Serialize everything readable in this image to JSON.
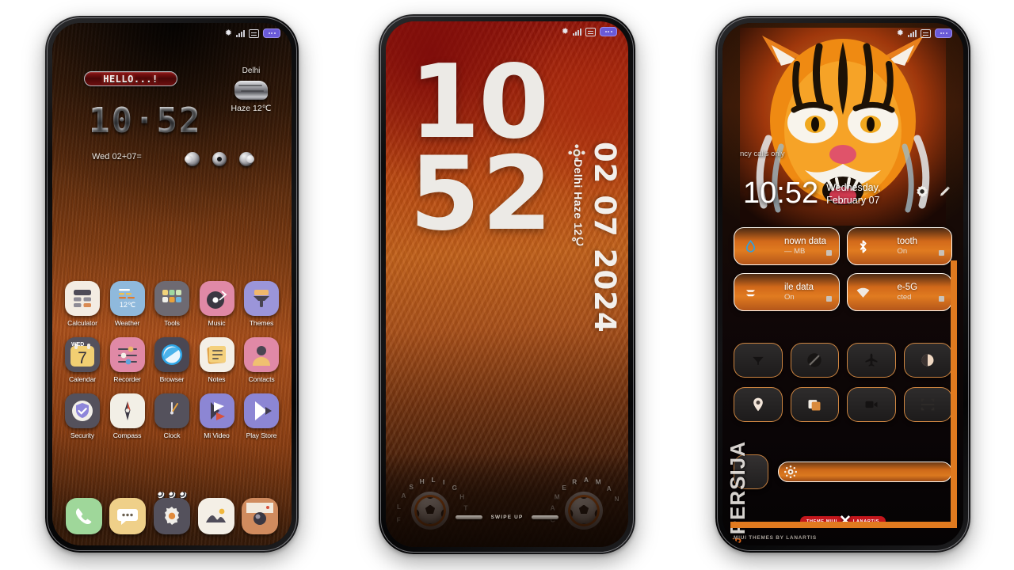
{
  "canvas": {
    "background": "#ffffff"
  },
  "phone1": {
    "statusbar": {
      "bluetooth": "bluetooth-icon",
      "signal": "signal-bars-icon",
      "alarm": "alarm-icon",
      "battery": "battery-icon"
    },
    "greeting": "HELLO...!",
    "clock": "10·52",
    "date": "Wed 02+07=",
    "weather": {
      "city": "Delhi",
      "condition": "Haze 12℃"
    },
    "apps_row1": [
      {
        "label": "Calculator",
        "icon": "calculator-icon",
        "bg": "#f3ece2"
      },
      {
        "label": "Weather",
        "icon": "weather-icon",
        "bg": "#8fb9dc"
      },
      {
        "label": "Tools",
        "icon": "tools-folder-icon",
        "bg": "#6e6a72"
      },
      {
        "label": "Music",
        "icon": "music-icon",
        "bg": "#e089a6"
      },
      {
        "label": "Themes",
        "icon": "themes-icon",
        "bg": "#9b95d9"
      }
    ],
    "apps_row2": [
      {
        "label": "Calendar",
        "icon": "calendar-icon",
        "bg": "#54515c",
        "day": "7",
        "weekday": "WED"
      },
      {
        "label": "Recorder",
        "icon": "recorder-icon",
        "bg": "#e089a6"
      },
      {
        "label": "Browser",
        "icon": "browser-icon",
        "bg": "#4a4753"
      },
      {
        "label": "Notes",
        "icon": "notes-icon",
        "bg": "#f4efe6"
      },
      {
        "label": "Contacts",
        "icon": "contacts-icon",
        "bg": "#e089a6"
      }
    ],
    "apps_row3": [
      {
        "label": "Security",
        "icon": "security-shield-icon",
        "bg": "#54515c"
      },
      {
        "label": "Compass",
        "icon": "compass-icon",
        "bg": "#f2efe6"
      },
      {
        "label": "Clock",
        "icon": "clock-icon",
        "bg": "#54515c"
      },
      {
        "label": "Mi Video",
        "icon": "mi-video-icon",
        "bg": "#8c86d4"
      },
      {
        "label": "Play Store",
        "icon": "play-store-icon",
        "bg": "#8c86d4"
      }
    ],
    "dock": [
      {
        "label": "Phone",
        "icon": "phone-icon",
        "bg": "#9fd79a"
      },
      {
        "label": "Messages",
        "icon": "messages-icon",
        "bg": "#efd089"
      },
      {
        "label": "Settings",
        "icon": "settings-gear-icon",
        "bg": "#54515c"
      },
      {
        "label": "Gallery",
        "icon": "gallery-icon",
        "bg": "#f4efe6"
      },
      {
        "label": "Camera",
        "icon": "camera-icon",
        "bg": "#d08b5e"
      }
    ],
    "page_dots": 3
  },
  "phone2": {
    "statusbar": {
      "bluetooth": "bluetooth-icon",
      "signal": "signal-bars-icon",
      "alarm": "alarm-icon",
      "battery": "battery-icon"
    },
    "clock_hour": "10",
    "clock_min": "52",
    "date_vertical": "02 07 2024",
    "weather_vertical": "Delhi Haze 12℃",
    "left_shortcut": "FLASHLIGHT",
    "right_shortcut": "CAMERAMAN",
    "swipe_hint": "SWIPE UP",
    "accent": "#e06a14"
  },
  "phone3": {
    "statusbar": {
      "bluetooth": "bluetooth-icon",
      "signal": "signal-bars-icon",
      "alarm": "alarm-icon",
      "battery": "battery-icon"
    },
    "carrier": "ncy calls only",
    "clock": "10:52",
    "date": "Wednesday, February 07",
    "header_icons": [
      "settings-gear-icon",
      "edit-pencil-icon"
    ],
    "tiles": [
      {
        "title": "nown data",
        "sub": "— MB",
        "icon": "data-usage-icon"
      },
      {
        "title": "tooth",
        "sub": "On",
        "icon": "bluetooth-icon"
      },
      {
        "title": "ile data",
        "sub": "On",
        "icon": "mobile-data-icon"
      },
      {
        "title": "e-5G",
        "sub": "cted",
        "icon": "wifi-icon"
      }
    ],
    "toggles_row1": [
      "hotspot-icon",
      "silent-mode-icon",
      "airplane-mode-icon",
      "dark-mode-icon"
    ],
    "toggles_row2": [
      "location-icon",
      "screenshot-icon",
      "screen-record-icon",
      "scanner-icon"
    ],
    "brightness_icon": "brightness-icon",
    "brand": "PERSIJA",
    "brand_mark": "JP",
    "badge_left": "THEME MIUI",
    "badge_x": "✕",
    "badge_right": "LANARTIS",
    "footer": "MIUI THEMES BY LANARTIS",
    "accent": "#e07a1f"
  }
}
